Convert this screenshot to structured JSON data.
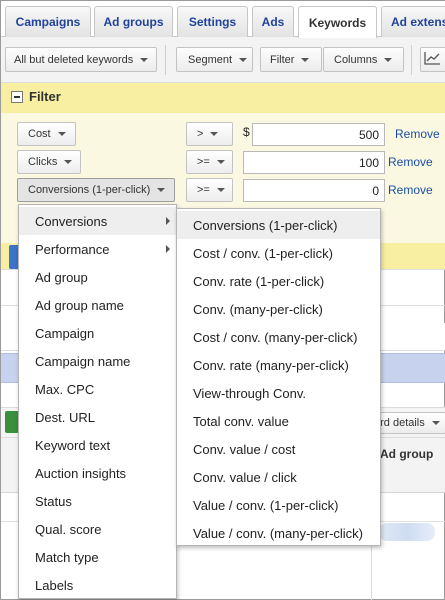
{
  "tabs": [
    "Campaigns",
    "Ad groups",
    "Settings",
    "Ads",
    "Keywords",
    "Ad extens"
  ],
  "toolbar": {
    "view_filter": "All but deleted keywords",
    "segment": "Segment",
    "filter": "Filter",
    "columns": "Columns"
  },
  "filter": {
    "title": "Filter",
    "rows": [
      {
        "metric": "Cost",
        "operator": ">",
        "currency": "$",
        "value": "500",
        "remove": "Remove"
      },
      {
        "metric": "Clicks",
        "operator": ">=",
        "currency": "",
        "value": "100",
        "remove": "Remove"
      },
      {
        "metric": "Conversions (1-per-click)",
        "operator": ">=",
        "currency": "",
        "value": "0",
        "remove": "Remove"
      }
    ]
  },
  "background": {
    "keyword_details": "ord details",
    "column_header": "Ad group"
  },
  "category_menu": {
    "items": [
      "Conversions",
      "Performance",
      "Ad group",
      "Ad group name",
      "Campaign",
      "Campaign name",
      "Max. CPC",
      "Dest. URL",
      "Keyword text",
      "Auction insights",
      "Status",
      "Qual. score",
      "Match type",
      "Labels"
    ]
  },
  "submenu": {
    "items": [
      "Conversions (1-per-click)",
      "Cost / conv. (1-per-click)",
      "Conv. rate (1-per-click)",
      "Conv. (many-per-click)",
      "Cost / conv. (many-per-click)",
      "Conv. rate (many-per-click)",
      "View-through Conv.",
      "Total conv. value",
      "Conv. value / cost",
      "Conv. value / click",
      "Value / conv. (1-per-click)",
      "Value / conv. (many-per-click)"
    ]
  },
  "colors": {
    "link": "#1b4fa5",
    "tab_text": "#21439c",
    "filter_header": "#f8efa2",
    "filter_body": "#fbf8e2"
  }
}
